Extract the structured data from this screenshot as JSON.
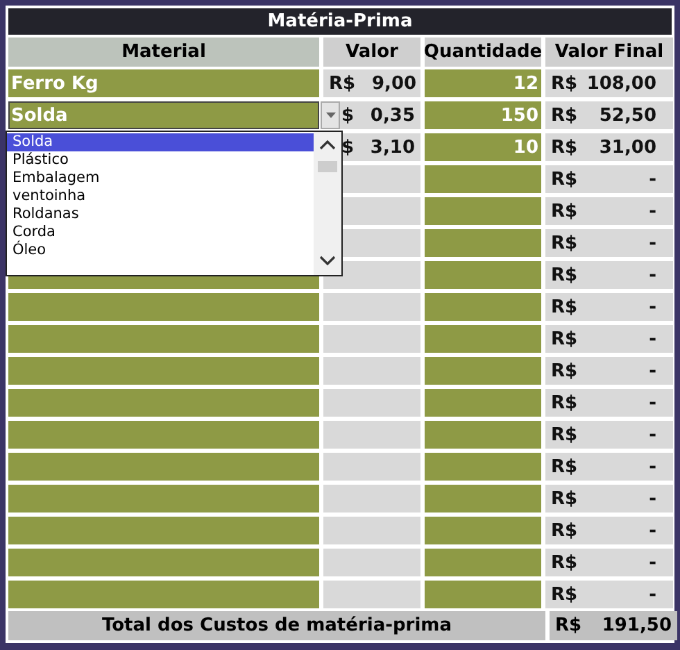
{
  "title": "Matéria-Prima",
  "columns": [
    "Material",
    "Valor",
    "Quantidade",
    "Valor Final"
  ],
  "rows": [
    {
      "material": "Ferro Kg",
      "currency": "R$",
      "valor": "9,00",
      "quantidade": "12",
      "final_currency": "R$",
      "final": "108,00",
      "selected": false
    },
    {
      "material": "Solda",
      "currency": "$",
      "valor": "0,35",
      "quantidade": "150",
      "final_currency": "R$",
      "final": "52,50",
      "selected": true
    },
    {
      "currency": "$",
      "valor": "3,10",
      "quantidade": "10",
      "final_currency": "R$",
      "final": "31,00"
    },
    {
      "final_currency": "R$",
      "final": "-"
    },
    {
      "final_currency": "R$",
      "final": "-"
    },
    {
      "final_currency": "R$",
      "final": "-"
    },
    {
      "final_currency": "R$",
      "final": "-",
      "selected": false
    },
    {
      "final_currency": "R$",
      "final": "-",
      "selected": false
    },
    {
      "final_currency": "R$",
      "final": "-",
      "selected": false
    },
    {
      "final_currency": "R$",
      "final": "-",
      "selected": false
    },
    {
      "final_currency": "R$",
      "final": "-",
      "selected": false
    },
    {
      "final_currency": "R$",
      "final": "-",
      "selected": false
    },
    {
      "final_currency": "R$",
      "final": "-",
      "selected": false
    },
    {
      "final_currency": "R$",
      "final": "-",
      "selected": false
    },
    {
      "final_currency": "R$",
      "final": "-",
      "selected": false
    },
    {
      "final_currency": "R$",
      "final": "-",
      "selected": false
    },
    {
      "final_currency": "R$",
      "final": "-",
      "selected": false
    }
  ],
  "dropdown": {
    "items": [
      {
        "label": "Solda",
        "selected": true
      },
      {
        "label": "Plástico",
        "selected": false
      },
      {
        "label": "Embalagem",
        "selected": false
      },
      {
        "label": "ventoinha",
        "selected": false
      },
      {
        "label": "Roldanas",
        "selected": false
      },
      {
        "label": "Corda",
        "selected": false
      },
      {
        "label": "Óleo",
        "selected": false
      }
    ]
  },
  "total": {
    "label": "Total dos Custos de matéria-prima",
    "currency": "R$",
    "value": "191,50"
  }
}
